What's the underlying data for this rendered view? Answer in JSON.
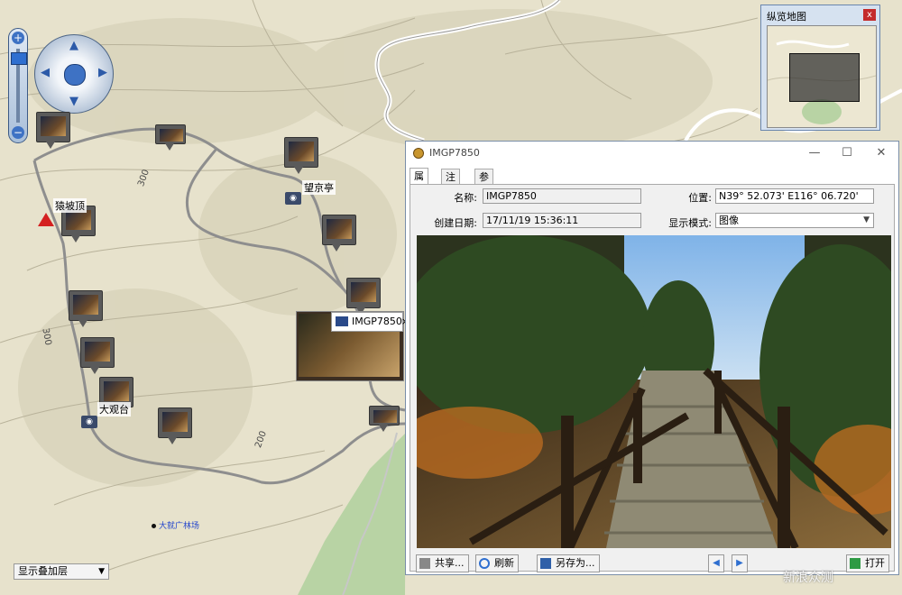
{
  "overview": {
    "title": "纵览地图",
    "close": "x"
  },
  "map": {
    "labels": {
      "peak": "猿坡顶",
      "pavilion": "望京亭",
      "platform": "大观台",
      "place": "大就广林场"
    },
    "contours": [
      "300",
      "300",
      "200"
    ],
    "popup_title": "IMGP7850",
    "popup_close": "×"
  },
  "zoom": {
    "plus": "+",
    "minus": "−"
  },
  "layer_select": {
    "value": "显示叠加层"
  },
  "window": {
    "title": "IMGP7850",
    "controls": {
      "minimize": "—",
      "maximize": "☐",
      "close": "✕"
    },
    "tabs": [
      {
        "label": "属性"
      },
      {
        "label": "注释"
      },
      {
        "label": "参考"
      }
    ],
    "fields": {
      "name_label": "名称:",
      "name_value": "IMGP7850",
      "position_label": "位置:",
      "position_value": "N39° 52.073' E116° 06.720'",
      "date_label": "创建日期:",
      "date_value": "17/11/19 15:36:11",
      "mode_label": "显示模式:",
      "mode_value": "图像"
    },
    "buttons": {
      "share": "共享...",
      "refresh": "刷新",
      "save_as": "另存为...",
      "open": "打开"
    }
  },
  "watermark": "新浪众测"
}
